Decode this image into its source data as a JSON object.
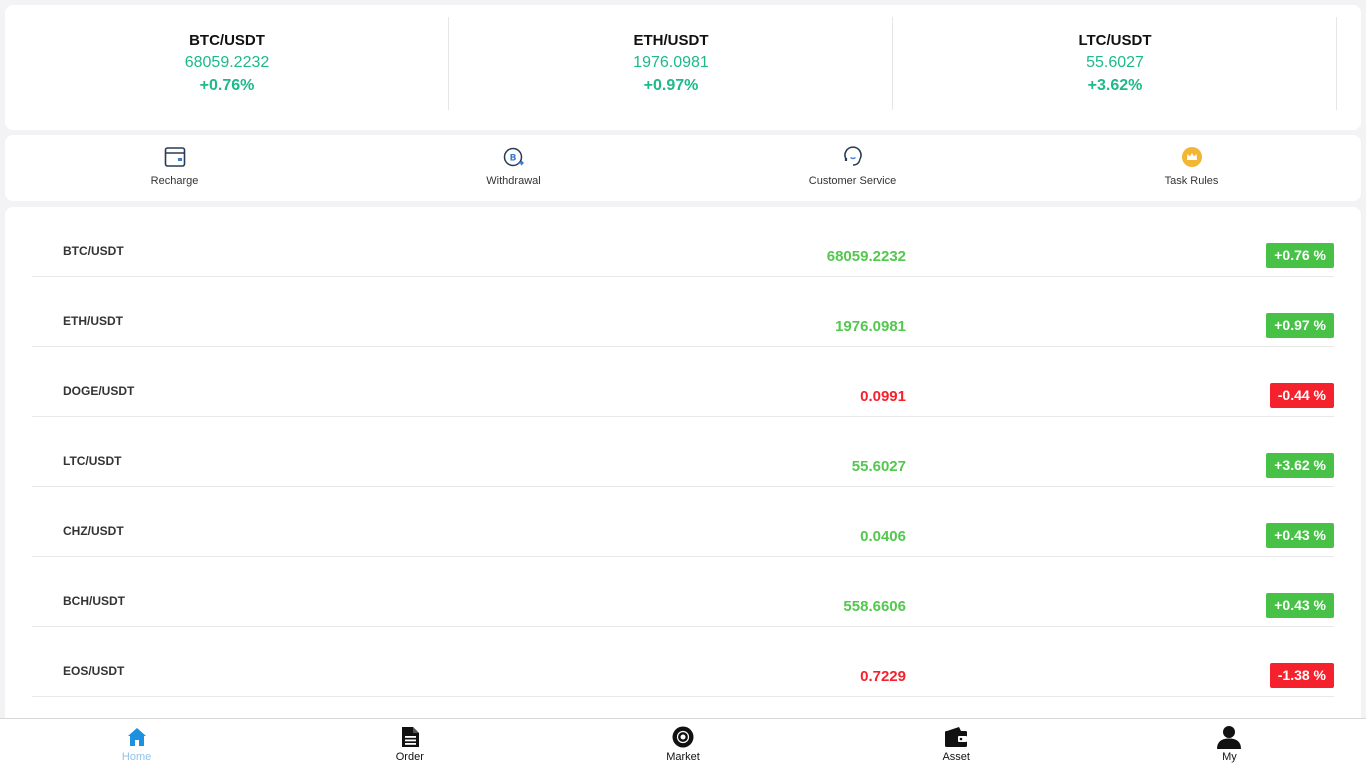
{
  "tickers": [
    {
      "pair": "BTC/USDT",
      "price": "68059.2232",
      "change": "+0.76%"
    },
    {
      "pair": "ETH/USDT",
      "price": "1976.0981",
      "change": "+0.97%"
    },
    {
      "pair": "LTC/USDT",
      "price": "55.6027",
      "change": "+3.62%"
    }
  ],
  "shortcuts": [
    {
      "label": "Recharge",
      "icon": "wallet-card-icon"
    },
    {
      "label": "Withdrawal",
      "icon": "bitcoin-withdraw-icon"
    },
    {
      "label": "Customer Service",
      "icon": "headset-icon"
    },
    {
      "label": "Task Rules",
      "icon": "crown-icon"
    }
  ],
  "markets": [
    {
      "pair": "BTC/USDT",
      "price": "68059.2232",
      "change": "+0.76 %",
      "trend": "up"
    },
    {
      "pair": "ETH/USDT",
      "price": "1976.0981",
      "change": "+0.97 %",
      "trend": "up"
    },
    {
      "pair": "DOGE/USDT",
      "price": "0.0991",
      "change": "-0.44 %",
      "trend": "down"
    },
    {
      "pair": "LTC/USDT",
      "price": "55.6027",
      "change": "+3.62 %",
      "trend": "up"
    },
    {
      "pair": "CHZ/USDT",
      "price": "0.0406",
      "change": "+0.43 %",
      "trend": "up"
    },
    {
      "pair": "BCH/USDT",
      "price": "558.6606",
      "change": "+0.43 %",
      "trend": "up"
    },
    {
      "pair": "EOS/USDT",
      "price": "0.7229",
      "change": "-1.38 %",
      "trend": "down"
    }
  ],
  "nav": [
    {
      "label": "Home",
      "icon": "home-icon",
      "active": true
    },
    {
      "label": "Order",
      "icon": "document-icon",
      "active": false
    },
    {
      "label": "Market",
      "icon": "market-icon",
      "active": false
    },
    {
      "label": "Asset",
      "icon": "wallet-icon",
      "active": false
    },
    {
      "label": "My",
      "icon": "user-icon",
      "active": false
    }
  ],
  "colors": {
    "up": "#47c247",
    "down": "#f5222d",
    "ticker": "#1cb98a",
    "nav_active": "#1e90e0"
  }
}
